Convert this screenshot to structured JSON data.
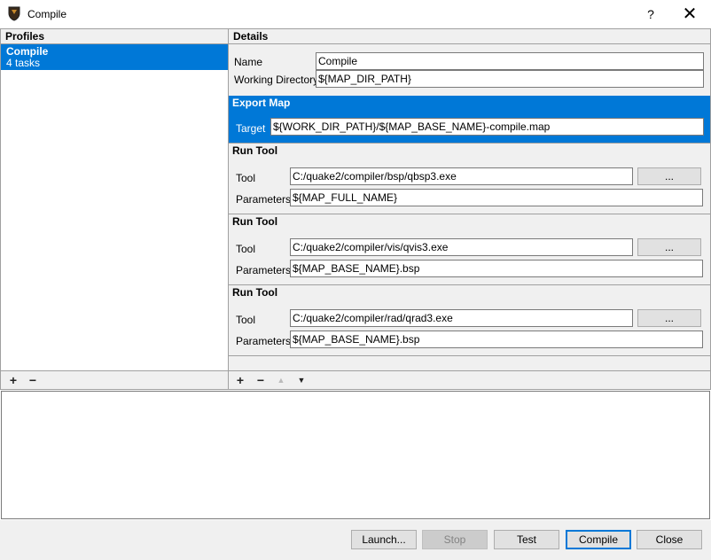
{
  "window": {
    "title": "Compile",
    "help_label": "?",
    "close_label": "✕",
    "icon": "shield-icon"
  },
  "profiles": {
    "header": "Profiles",
    "items": [
      {
        "name": "Compile",
        "count": "4 tasks"
      }
    ],
    "add_label": "+",
    "remove_label": "−"
  },
  "details": {
    "header": "Details",
    "name_label": "Name",
    "name_value": "Compile",
    "workdir_label": "Working Directory",
    "workdir_value": "${MAP_DIR_PATH}"
  },
  "tasks": [
    {
      "title": "Export Map",
      "target_label": "Target",
      "target_value": "${WORK_DIR_PATH}/${MAP_BASE_NAME}-compile.map"
    },
    {
      "title": "Run Tool",
      "tool_label": "Tool",
      "tool_value": "C:/quake2/compiler/bsp/qbsp3.exe",
      "browse_label": "...",
      "params_label": "Parameters",
      "params_value": "${MAP_FULL_NAME}"
    },
    {
      "title": "Run Tool",
      "tool_label": "Tool",
      "tool_value": "C:/quake2/compiler/vis/qvis3.exe",
      "browse_label": "...",
      "params_label": "Parameters",
      "params_value": "${MAP_BASE_NAME}.bsp"
    },
    {
      "title": "Run Tool",
      "tool_label": "Tool",
      "tool_value": "C:/quake2/compiler/rad/qrad3.exe",
      "browse_label": "...",
      "params_label": "Parameters",
      "params_value": "${MAP_BASE_NAME}.bsp"
    }
  ],
  "task_toolbar": {
    "add_label": "+",
    "remove_label": "−",
    "up_label": "▲",
    "down_label": "▼"
  },
  "buttons": {
    "launch": "Launch...",
    "stop": "Stop",
    "test": "Test",
    "compile": "Compile",
    "close": "Close"
  },
  "colors": {
    "selection": "#0078d7",
    "panel": "#f0f0f0"
  }
}
